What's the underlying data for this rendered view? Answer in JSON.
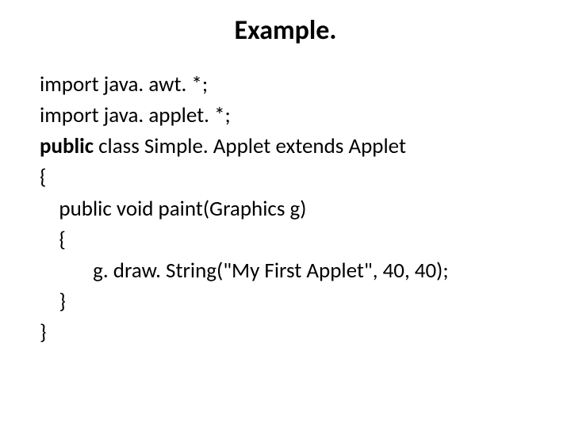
{
  "title": "Example.",
  "code": {
    "l1a": "import java. awt. *;",
    "l2a": "import java. applet. *;",
    "l3a": "public",
    "l3b": " class Simple. Applet extends Applet",
    "l4": "{",
    "l5": "    public void paint(Graphics g)",
    "l6": "    {",
    "l7": "           g. draw. String(\"My First Applet\", 40, 40);",
    "l8": "    }",
    "l9": "}"
  }
}
